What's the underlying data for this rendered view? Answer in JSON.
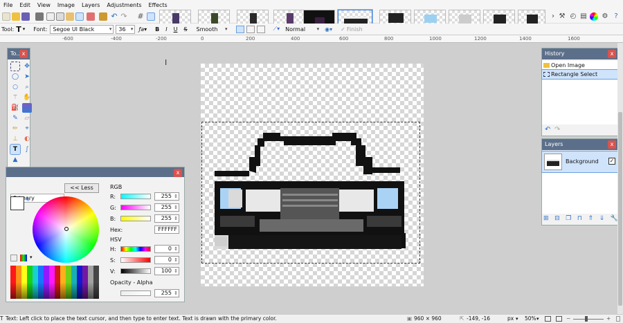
{
  "menu": [
    "File",
    "Edit",
    "View",
    "Image",
    "Layers",
    "Adjustments",
    "Effects"
  ],
  "toolbar": {
    "tool_label": "Tool:",
    "font_label": "Font:",
    "font_value": "Segoe UI Black",
    "size_value": "36",
    "bold": "B",
    "italic": "I",
    "underline": "U",
    "strike": "S",
    "smoothing_value": "Smooth",
    "blend_value": "Normal",
    "finish_label": "Finish"
  },
  "ruler": {
    "labels": [
      "-600",
      "-400",
      "-200",
      "0",
      "200",
      "400",
      "600",
      "800",
      "1000",
      "1200",
      "1400",
      "1600"
    ]
  },
  "tools_panel": {
    "title": "To..."
  },
  "history_panel": {
    "title": "History",
    "items": [
      "Open Image",
      "Rectangle Select"
    ],
    "selected_index": 1
  },
  "layers_panel": {
    "title": "Layers",
    "layers": [
      {
        "name": "Background",
        "visible": true
      }
    ]
  },
  "colors_panel": {
    "palette_select": "Primary",
    "less_button": "<< Less",
    "rgb_label": "RGB",
    "r_label": "R:",
    "r_value": "255",
    "g_label": "G:",
    "g_value": "255",
    "b_label": "B:",
    "b_value": "255",
    "hex_label": "Hex:",
    "hex_value": "FFFFFF",
    "hsv_label": "HSV",
    "h_label": "H:",
    "h_value": "0",
    "s_label": "S:",
    "s_value": "0",
    "v_label": "V:",
    "v_value": "100",
    "opacity_label": "Opacity - Alpha",
    "alpha_value": "255"
  },
  "status": {
    "hint": "Text: Left click to place the text cursor, and then type to enter text. Text is drawn with the primary color.",
    "image_size": "960 × 960",
    "cursor_pos": "-149, -16",
    "unit": "px",
    "zoom": "50%"
  },
  "colors": {
    "accent": "#3a7bd5",
    "panel_title": "#5c6f8a",
    "close": "#d9534f",
    "selection_bg": "#cfe3fb"
  }
}
